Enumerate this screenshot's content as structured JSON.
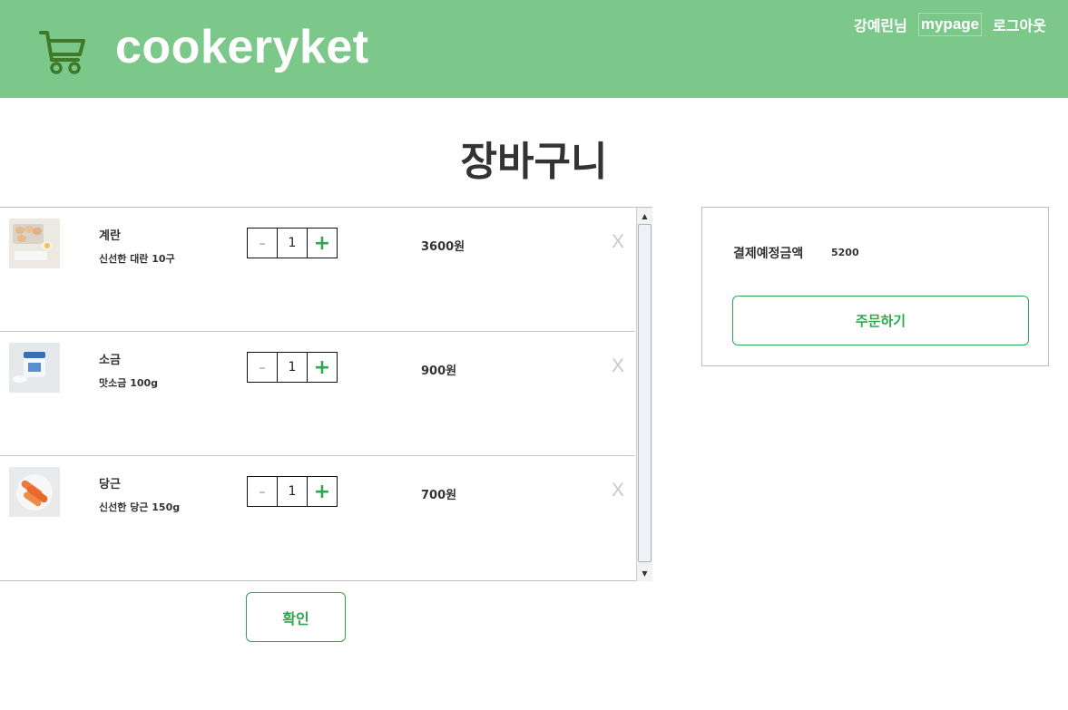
{
  "header": {
    "logo_text": "cookeryket",
    "user_name": "강예린님",
    "mypage_label": "mypage",
    "logout_label": "로그아웃"
  },
  "page_title": "장바구니",
  "cart": {
    "items": [
      {
        "name": "계란",
        "desc": "신선한 대란 10구",
        "qty": "1",
        "price": "3600원",
        "minus": "-",
        "plus": "+",
        "remove": "X",
        "image": "eggs-thumbnail"
      },
      {
        "name": "소금",
        "desc": "맛소금 100g",
        "qty": "1",
        "price": "900원",
        "minus": "-",
        "plus": "+",
        "remove": "X",
        "image": "salt-thumbnail"
      },
      {
        "name": "당근",
        "desc": "신선한 당근 150g",
        "qty": "1",
        "price": "700원",
        "minus": "-",
        "plus": "+",
        "remove": "X",
        "image": "carrot-thumbnail"
      }
    ],
    "confirm_label": "확인"
  },
  "summary": {
    "label": "결제예정금액",
    "amount": "5200",
    "order_label": "주문하기"
  },
  "colors": {
    "header_bg": "#7cc88a",
    "accent_green": "#2ea84f"
  }
}
